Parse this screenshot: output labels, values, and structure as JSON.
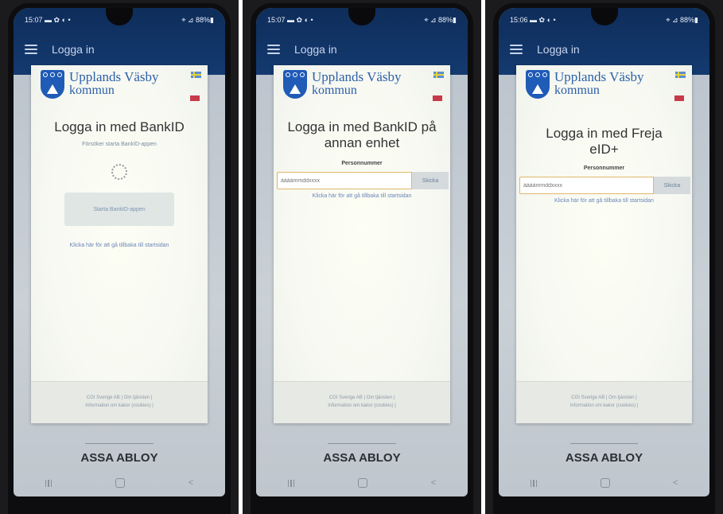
{
  "panels": [
    {
      "status_time": "15:07",
      "status_icons": "▬ ✿ ◐ •",
      "status_right": "⌖ ⊿ 88%▮",
      "app_title": "Logga in",
      "brand_line1": "Upplands Väsby",
      "brand_line2": "kommun",
      "heading": "Logga in med BankID",
      "subtext": "Försöker starta BankID-appen",
      "button_label": "Starta BankID-appen",
      "back_link": "Klicka här för att gå tillbaka till startsidan",
      "footer_line1": "CGI Sverige AB | Om tjänsten |",
      "footer_line2": "Information om kakor (cookies) |",
      "brand_bottom": "ASSA ABLOY",
      "nav": [
        "|||",
        "◯",
        "<"
      ]
    },
    {
      "status_time": "15:07",
      "status_icons": "▬ ✿ ◐ •",
      "status_right": "⌖ ⊿ 88%▮",
      "app_title": "Logga in",
      "brand_line1": "Upplands Väsby",
      "brand_line2": "kommun",
      "heading": "Logga in med BankID på annan enhet",
      "field_label": "Personnummer",
      "field_placeholder": "ååååmmddxxxx",
      "send_label": "Skicka",
      "back_link": "Klicka här för att gå tillbaka till startsidan",
      "footer_line1": "CGI Sverige AB | Om tjänsten |",
      "footer_line2": "Information om kakor (cookies) |",
      "brand_bottom": "ASSA ABLOY",
      "nav": [
        "|||",
        "◯",
        "<"
      ]
    },
    {
      "status_time": "15:06",
      "status_icons": "▬ ✿ ◐ •",
      "status_right": "⌖ ⊿ 88%▮",
      "app_title": "Logga in",
      "brand_line1": "Upplands Väsby",
      "brand_line2": "kommun",
      "heading": "Logga in med Freja eID+",
      "field_label": "Personnummer",
      "field_placeholder": "ååååmmddxxxx",
      "send_label": "Skicka",
      "back_link": "Klicka här för att gå tillbaka till startsidan",
      "footer_line1": "CGI Sverige AB | Om tjänsten |",
      "footer_line2": "Information om kakor (cookies) |",
      "brand_bottom": "ASSA ABLOY",
      "nav": [
        "|||",
        "◯",
        "<"
      ]
    }
  ]
}
